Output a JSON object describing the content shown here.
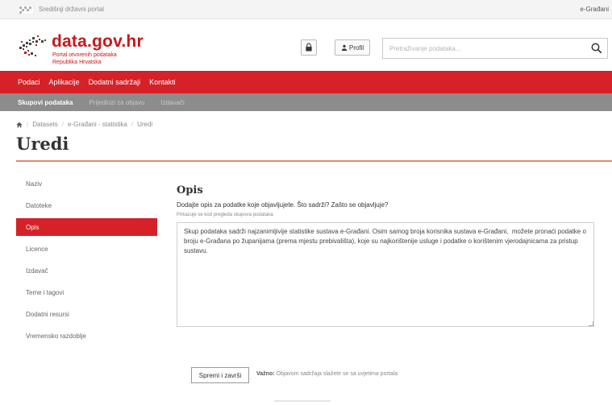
{
  "topbar": {
    "portal_link": "Središnji državni portal",
    "egradjani_link": "e-Građani"
  },
  "header": {
    "logo_title": "data.gov.hr",
    "logo_sub1": "Portal otvorenih podataka",
    "logo_sub2": "Republika Hrvatska",
    "profil_label": "Profil",
    "search_placeholder": "Pretraživanje podataka..."
  },
  "nav_main": {
    "items": [
      "Podaci",
      "Aplikacije",
      "Dodatni sadržaji",
      "Kontakti"
    ]
  },
  "nav_sub": {
    "items": [
      "Skupovi podataka",
      "Prijedlozi za objavu",
      "Izdavači"
    ],
    "active_index": 0
  },
  "breadcrumb": {
    "items": [
      "Datasets",
      "e-Građani - statistika",
      "Uredi"
    ]
  },
  "page_title": "Uredi",
  "sidebar": {
    "items": [
      "Naziv",
      "Datoteke",
      "Opis",
      "Licence",
      "Izdavač",
      "Teme i tagovi",
      "Dodatni resursi",
      "Vremensko razdoblje"
    ],
    "active_index": 2
  },
  "form": {
    "section_title": "Opis",
    "question": "Dodajte opis za podatke koje objavljujete. Što sadrži? Zašto se objavljuje?",
    "hint": "Prikazuje se kod pregleda skupova podataka.",
    "description_value": "Skup podataka sadrži najzanimljivije statistike sustava e-Građani. Osim samog broja korisnika sustava e-Građani,  možete pronaći podatke o broju e-Građana po županijama (prema mjestu prebivališta), koje su najkorištenije usluge i podatke o korištenim vjerodajnicama za pristup sustavu."
  },
  "actions": {
    "save_label": "Spremi i završi",
    "notice_label": "Važno:",
    "notice_text": "Objavom sadržaja slažete se sa uvjetima portala"
  },
  "colors": {
    "brand_red": "#d52127",
    "sub_nav_gray": "#8c8c8c",
    "title_rule": "#e08a6f"
  }
}
